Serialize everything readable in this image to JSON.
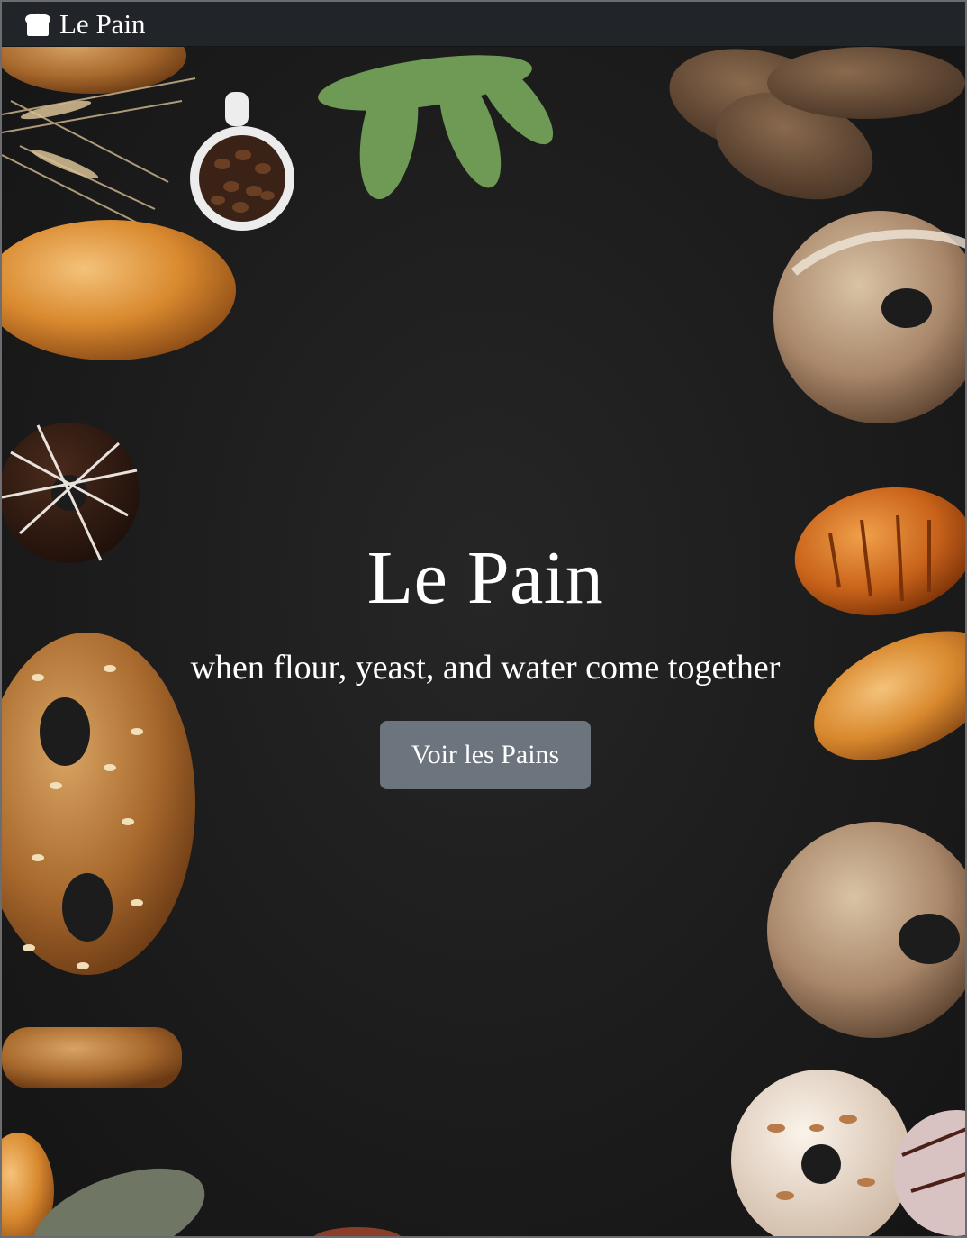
{
  "navbar": {
    "brand_icon": "bread-loaf-icon",
    "brand_label": "Le Pain"
  },
  "hero": {
    "title": "Le Pain",
    "tagline": "when flour, yeast, and water come together",
    "button_label": "Voir les Pains"
  },
  "colors": {
    "navbar_background": "#212529",
    "hero_background": "#1c1c1c",
    "button_background": "#6c757d",
    "text": "#ffffff"
  }
}
